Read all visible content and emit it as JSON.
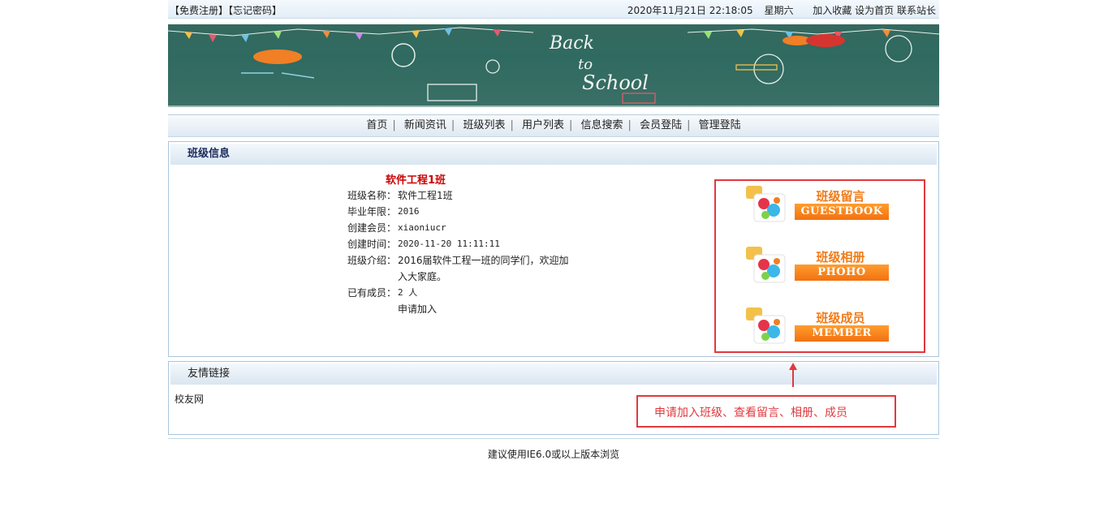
{
  "topbar": {
    "register": "【免费注册】",
    "forgot": "【忘记密码】",
    "datetime": "2020年11月21日 22:18:05",
    "weekday": "星期六",
    "bookmark": "加入收藏",
    "homepage": "设为首页",
    "contact": "联系站长"
  },
  "banner": {
    "chalk_text_1": "Back",
    "chalk_text_2": "to",
    "chalk_text_3": "School"
  },
  "nav": {
    "items": [
      {
        "label": "首页"
      },
      {
        "label": "新闻资讯"
      },
      {
        "label": "班级列表"
      },
      {
        "label": "用户列表"
      },
      {
        "label": "信息搜索"
      },
      {
        "label": "会员登陆"
      },
      {
        "label": "管理登陆"
      }
    ]
  },
  "class_info": {
    "heading": "班级信息",
    "class_title": "软件工程1班",
    "rows": [
      {
        "key": "班级名称：",
        "value": "软件工程1班"
      },
      {
        "key": "毕业年限：",
        "value": "2016"
      },
      {
        "key": "创建会员：",
        "value": "xiaoniucr"
      },
      {
        "key": "创建时间：",
        "value": "2020-11-20 11:11:11"
      },
      {
        "key": "班级介绍：",
        "value": "2016届软件工程一班的同学们，欢迎加"
      },
      {
        "key": "",
        "value": "入大家庭。"
      },
      {
        "key": "已有成员：",
        "value": "2 人"
      },
      {
        "key": "",
        "value": "申请加入"
      }
    ]
  },
  "class_buttons": [
    {
      "cn": "班级留言",
      "en": "GUESTBOOK"
    },
    {
      "cn": "班级相册",
      "en": "PHOHO"
    },
    {
      "cn": "班级成员",
      "en": "MEMBER"
    }
  ],
  "friend_links": {
    "heading": "友情链接",
    "items": [
      {
        "label": "校友网"
      }
    ]
  },
  "annotation": "申请加入班级、查看留言、相册、成员",
  "footer": "建议使用IE6.0或以上版本浏览",
  "colors": {
    "accent_red": "#e0393e",
    "title_red": "#cc0000",
    "button_orange": "#f27110",
    "board_green": "#35695f"
  }
}
